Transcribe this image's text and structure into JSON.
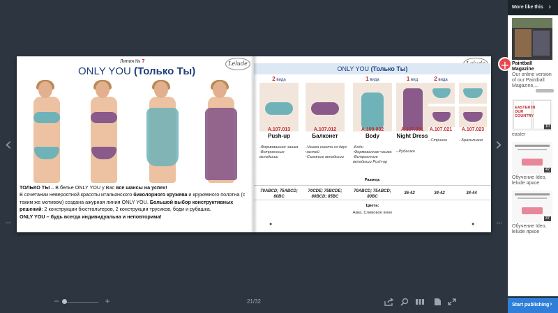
{
  "viewer": {
    "page_indicator": "21/32",
    "zoom_minus": "−",
    "zoom_plus": "+",
    "prev_arrow": "‹",
    "next_arrow": "›"
  },
  "left_page": {
    "logo": "Lelude",
    "line_prefix": "Линия № ",
    "line_number": "7",
    "title_main": "ONLY YOU ",
    "title_paren": "(Только Ты)",
    "text_1_bold": "ТОЛЬКО ТЫ",
    "text_1_rest": " – В белье ONLY YOU у Вас ",
    "text_1_bold2": "все шансы на успех!",
    "text_2_a": "В сочетании невероятной красоты итальянского ",
    "text_2_bold": "биколорного кружева",
    "text_2_b": " и кружевного полотна (с таким же мотивом) создана ажурная линия ONLY YOU. ",
    "text_2_bold2": "Большой выбор конструктивных решений",
    "text_2_c": ": 2 конструкции бюстгальтеров, 2 конструкции трусиков, боди и рубашка.",
    "text_3_bold": "ONLY YOU – будь всегда индивидуальна и неповторима!"
  },
  "right_page": {
    "logo": "Lelude",
    "title_main": "ONLY YOU ",
    "title_paren": "(Только Ты)",
    "columns": [
      {
        "count": "2",
        "count_label": " вида",
        "article": "A.107.013",
        "name": "Push-up",
        "desc": "-Формованная чашка\n-Встроенные вкладыши",
        "size": "70ABCD; 75ABCD; 80BC"
      },
      {
        "count": "",
        "count_label": "",
        "article": "A.107.012",
        "name": "Балконет",
        "desc": "-Чашка сшита из двух частей\n-Съемные вкладыши",
        "size": "70CDE; 75BCDE; 80BCD; 85BC"
      },
      {
        "count": "1",
        "count_label": " вида",
        "article": "A.109.032",
        "name": "Body",
        "desc": "-Боди\n-Формованная чашка\n-Встроенные вкладыши Push-up",
        "size": "70ABCD; 75ABCD; 80BC"
      },
      {
        "count": "1",
        "count_label": " вид",
        "article": "A.107.031",
        "name": "Night Dress",
        "desc": "- Рубашка",
        "size": "36-42"
      },
      {
        "count": "2",
        "count_label": " вида",
        "article": "A.107.021",
        "name": "",
        "desc": "- Стринги",
        "size": "34-42"
      },
      {
        "count": "",
        "count_label": "",
        "article": "A.107.023",
        "name": "",
        "desc": "- Бразилиано",
        "size": "34-44"
      }
    ],
    "size_label": "Размер:",
    "color_label": "Цвета:",
    "color_value": "Аква, Сливовое вино"
  },
  "sidebar": {
    "title": "More like this",
    "items": [
      {
        "caption_bold": "Paintball Magazine",
        "caption": "Our online version of our Paintball Magazine,..."
      },
      {
        "caption_bold": "",
        "caption": "easter",
        "badge": "10",
        "thumb_text": "EASTER IN OUR COUNTRY"
      },
      {
        "caption_bold": "",
        "caption": "Обучение Ideo, lelude яркое",
        "badge": "42"
      },
      {
        "caption_bold": "",
        "caption": "Обучение Ideo, lelude яркое",
        "badge": "37"
      }
    ],
    "publish_label": "Start publishing"
  },
  "colors": {
    "background": "#2d3640",
    "accent_red": "#c0272d",
    "title_blue": "#1d3f7a",
    "aqua_lace": "#6fb3b8",
    "plum_lace": "#8a5a8a",
    "publish_blue": "#2f7fd8"
  }
}
